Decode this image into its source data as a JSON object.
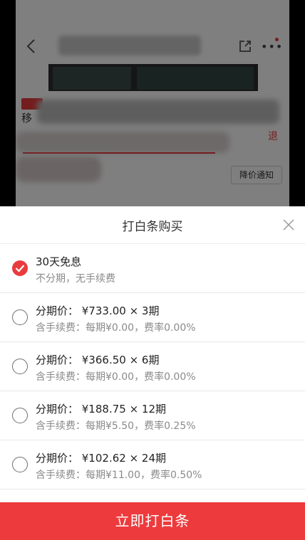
{
  "background": {
    "name_char": "移",
    "promo_link": "退",
    "notify_button": "降价通知"
  },
  "sheet": {
    "title": "打白条购买",
    "options": [
      {
        "line1": "30天免息",
        "line2": "不分期，无手续费",
        "selected": true
      },
      {
        "line1": "分期价： ¥733.00 × 3期",
        "line2": "含手续费：每期¥0.00，费率0.00%",
        "selected": false
      },
      {
        "line1": "分期价： ¥366.50 × 6期",
        "line2": "含手续费：每期¥0.00，费率0.00%",
        "selected": false
      },
      {
        "line1": "分期价： ¥188.75 × 12期",
        "line2": "含手续费：每期¥5.50，费率0.25%",
        "selected": false
      },
      {
        "line1": "分期价： ¥102.62 × 24期",
        "line2": "含手续费：每期¥11.00，费率0.50%",
        "selected": false
      }
    ],
    "submit_label": "立即打白条"
  },
  "colors": {
    "accent": "#e93b3d",
    "button": "#ed3a3c"
  }
}
